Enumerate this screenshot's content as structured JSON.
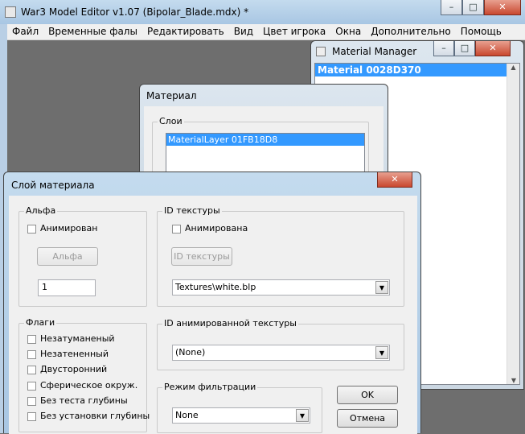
{
  "main_window": {
    "title": "War3 Model Editor v1.07 (Bipolar_Blade.mdx) *",
    "menu": [
      "Файл",
      "Временные фалы",
      "Редактировать",
      "Вид",
      "Цвет игрока",
      "Окна",
      "Дополнительно",
      "Помощь"
    ]
  },
  "material_manager": {
    "title": "Material Manager",
    "items": [
      "Material 0028D370"
    ]
  },
  "material_window": {
    "title": "Материал",
    "layers_label": "Слои",
    "layers": [
      "MaterialLayer 01FB18D8"
    ]
  },
  "layer_dialog": {
    "title": "Слой материала",
    "close_glyph": "✕",
    "alpha": {
      "label": "Альфа",
      "animated_label": "Анимирован",
      "button_label": "Альфа",
      "value": "1"
    },
    "texture_id": {
      "label": "ID текстуры",
      "animated_label": "Анимирована",
      "button_label": "ID текстуры",
      "selected": "Textures\\white.blp"
    },
    "flags": {
      "label": "Флаги",
      "items": [
        "Незатуманеный",
        "Незатененный",
        "Двусторонний",
        "Сферическое окруж.",
        "Без теста глубины",
        "Без установки глубины"
      ]
    },
    "animated_texture_id": {
      "label": "ID анимированной текстуры",
      "selected": "(None)"
    },
    "filter_mode": {
      "label": "Режим фильтрации",
      "selected": "None"
    },
    "ok_label": "OK",
    "cancel_label": "Отмена"
  },
  "icons": {
    "minimize": "–",
    "maximize": "□",
    "close": "✕",
    "dropdown": "▼"
  }
}
